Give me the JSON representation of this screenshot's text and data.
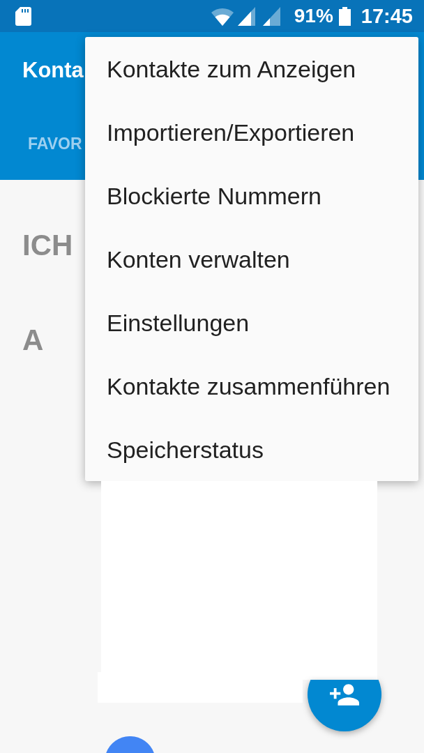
{
  "status_bar": {
    "battery": "91%",
    "time": "17:45"
  },
  "app_bar": {
    "title": "Konta",
    "tabs": [
      {
        "label": "FAVOR",
        "selected": false
      }
    ]
  },
  "contacts": {
    "sections": [
      {
        "header": "ICH"
      },
      {
        "header": "A"
      }
    ]
  },
  "overflow_menu": {
    "items": [
      {
        "label": "Kontakte zum Anzeigen"
      },
      {
        "label": "Importieren/Exportieren"
      },
      {
        "label": "Blockierte Nummern"
      },
      {
        "label": "Konten verwalten"
      },
      {
        "label": "Einstellungen"
      },
      {
        "label": "Kontakte zusammenführen"
      },
      {
        "label": "Speicherstatus"
      }
    ]
  }
}
